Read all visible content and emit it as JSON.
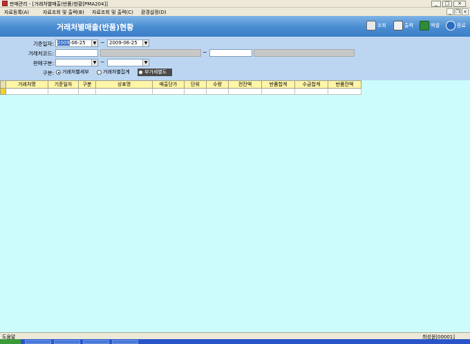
{
  "window": {
    "title": "판매관리 - [거래처별매출(반품)현황[PMA204]]"
  },
  "menu": {
    "items": [
      "자료등록(A)",
      "자료조회 및 출력(B)",
      "자료조회 및 출력(C)",
      "환경설정(D)"
    ]
  },
  "header": {
    "title": "거래처별매출(반품)현황",
    "buttons": [
      {
        "label": "조회",
        "icon": "search-doc-icon"
      },
      {
        "label": "출력",
        "icon": "printer-icon"
      },
      {
        "label": "엑셀",
        "icon": "excel-icon"
      },
      {
        "label": "종료",
        "icon": "power-icon"
      }
    ]
  },
  "filters": {
    "date_label": "기준일자:",
    "date_from_selected": "2009",
    "date_from_rest": "-06-25",
    "date_to": "2009-06-25",
    "customer_label": "거래처코드:",
    "sales_type_label": "판매구분:",
    "type_label": "구분:",
    "radios": [
      "거래처별세부",
      "거래처별집계",
      "부가세별도"
    ],
    "radio_selected": "거래처별세부",
    "tilde": "~"
  },
  "grid": {
    "columns": [
      "거래처명",
      "기준일자",
      "구분",
      "상표명",
      "매출단가",
      "단위",
      "수량",
      "전잔액",
      "반품합계",
      "수금합계",
      "반품잔액"
    ]
  },
  "status": {
    "left": "도움말",
    "right": "최성윤[00001]"
  },
  "colors": {
    "header_blue": "#4d8fd3",
    "filter_bg": "#bcd6f2",
    "grid_bg": "#ccfcfc",
    "grid_header": "#fff5a8"
  }
}
